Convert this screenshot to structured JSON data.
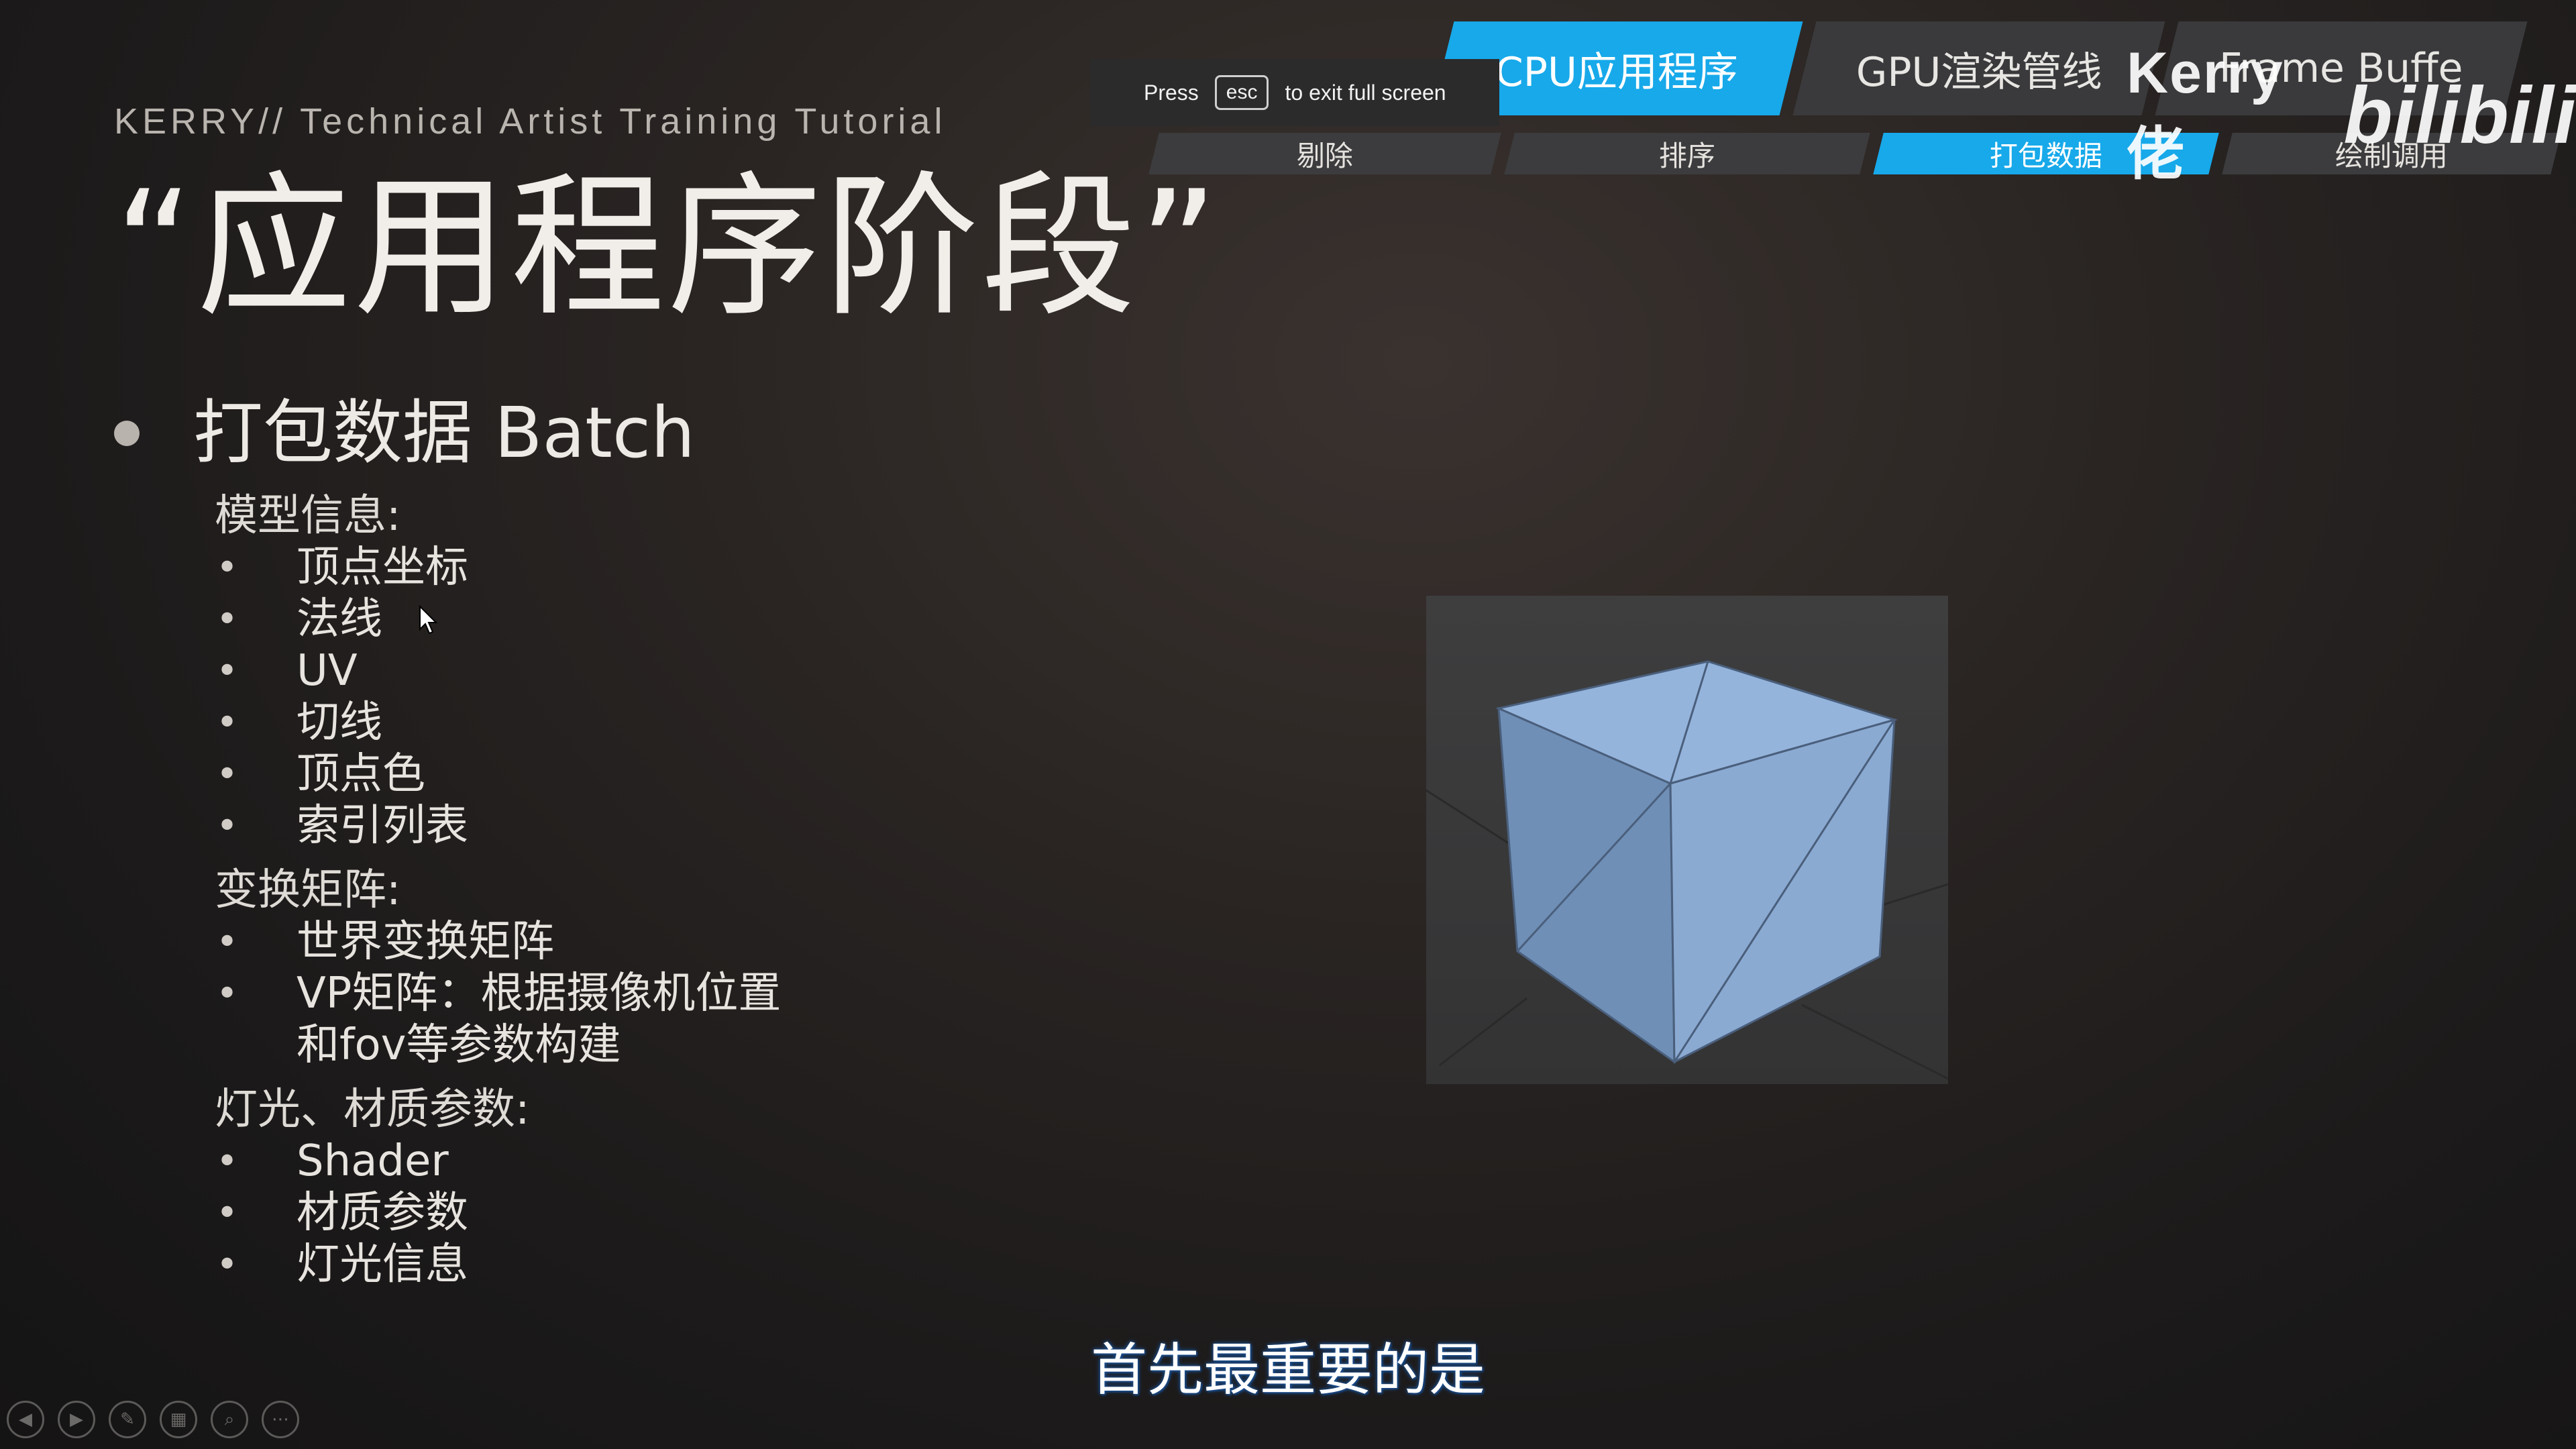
{
  "slide": {
    "subtitle": "KERRY// Technical Artist Training Tutorial",
    "title": "“应用程序阶段”",
    "bullet_heading": "打包数据 Batch",
    "groups": [
      {
        "title": "模型信息:",
        "items": [
          "顶点坐标",
          "法线",
          "UV",
          "切线",
          "顶点色",
          "索引列表"
        ]
      },
      {
        "title": "变换矩阵:",
        "items": [
          "世界变换矩阵",
          "VP矩阵：根据摄像机位置",
          "和fov等参数构建"
        ]
      },
      {
        "title": "灯光、材质参数:",
        "items": [
          "Shader",
          "材质参数",
          "灯光信息"
        ]
      }
    ]
  },
  "nav": {
    "tabs": [
      {
        "label": "CPU应用程序",
        "active": true
      },
      {
        "label": "GPU渲染管线",
        "active": false
      },
      {
        "label": "Frame Buffe",
        "active": false
      }
    ],
    "subtabs": [
      {
        "label": "剔除",
        "active": false
      },
      {
        "label": "排序",
        "active": false
      },
      {
        "label": "打包数据",
        "active": true
      },
      {
        "label": "绘制调用",
        "active": false
      }
    ]
  },
  "fullscreen_notice": {
    "press": "Press",
    "key": "esc",
    "message": "to exit full screen"
  },
  "watermark": {
    "text": "Kerry佬",
    "logo": "bilibili"
  },
  "caption": "首先最重要的是",
  "controls": [
    "prev-icon",
    "next-icon",
    "pen-icon",
    "slides-icon",
    "zoom-icon",
    "more-icon"
  ],
  "colors": {
    "accent": "#17a9ea",
    "cube": "#8fb0d8",
    "background": "#1c1a1a"
  }
}
